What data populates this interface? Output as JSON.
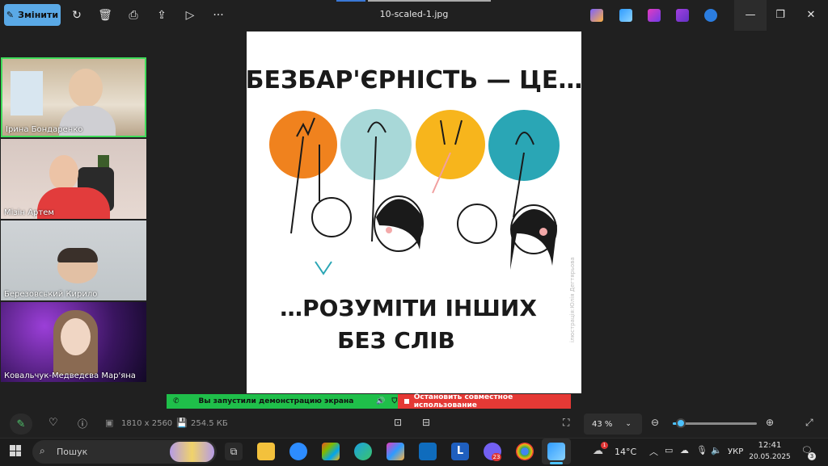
{
  "titlebar": {
    "edit_label": "Змінити",
    "file_name": "10-scaled-1.jpg"
  },
  "participants": [
    {
      "name": "Ірина Бондаренко"
    },
    {
      "name": "Мізін Артем"
    },
    {
      "name": "Березовський Кирило"
    },
    {
      "name": "Ковальчук-Медведєва Мар'яна"
    }
  ],
  "poster": {
    "headline": "БЕЗБАР'ЄРНІСТЬ — ЦЕ…",
    "subline1": "…РОЗУМІТИ ІНШИХ",
    "subline2": "БЕЗ СЛІВ",
    "credit": "ілюстрація:Юлія Дегтярьова",
    "colors": [
      "#f0821e",
      "#a8d8d8",
      "#f7b51c",
      "#2aa6b5"
    ]
  },
  "share": {
    "status": "Вы запустили демонстрацию экрана",
    "stop": "Остановить совместное использование"
  },
  "bottombar": {
    "dimensions": "1810 x 2560",
    "filesize": "254.5 КБ",
    "zoom": "43 %",
    "zoom_level": 0.1
  },
  "taskbar": {
    "search_placeholder": "Пошук",
    "weather": "14°C",
    "language": "УКР",
    "time": "12:41",
    "date": "20.05.2025",
    "notifications": "3",
    "viber_badge": "23",
    "weather_badge": "1"
  }
}
